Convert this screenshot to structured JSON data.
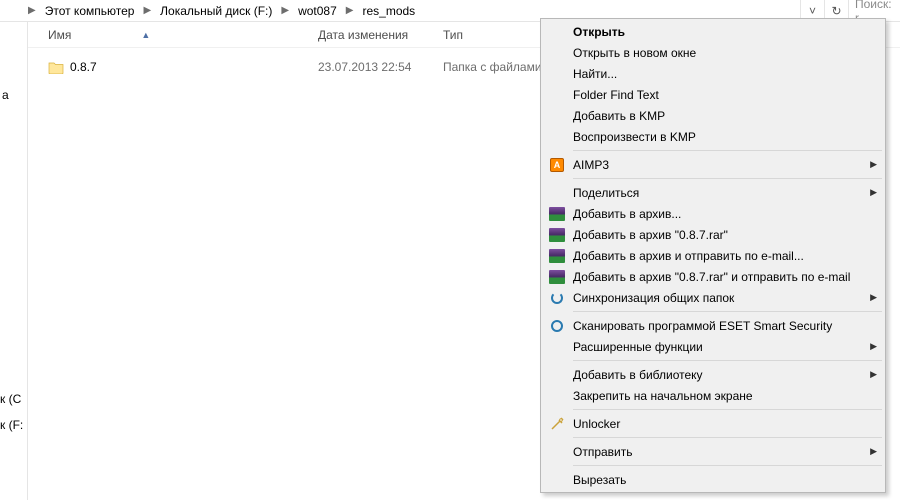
{
  "breadcrumb": {
    "items": [
      "Этот компьютер",
      "Локальный диск (F:)",
      "wot087",
      "res_mods"
    ]
  },
  "search": {
    "placeholder": "Поиск: r"
  },
  "columns": {
    "name": "Имя",
    "date": "Дата изменения",
    "type": "Тип"
  },
  "rows": [
    {
      "name": "0.8.7",
      "date": "23.07.2013 22:54",
      "type": "Папка с файлами"
    }
  ],
  "sidebar": {
    "item_a": "а",
    "item_c": "ск (C",
    "item_f": "ск (F:"
  },
  "context_menu": {
    "open": "Открыть",
    "open_new_window": "Открыть в новом окне",
    "find": "Найти...",
    "folder_find_text": "Folder Find Text",
    "add_kmp": "Добавить в KMP",
    "play_kmp": "Воспроизвести в KMP",
    "aimp3": "AIMP3",
    "share": "Поделиться",
    "add_archive": "Добавить в архив...",
    "add_archive_087": "Добавить в архив \"0.8.7.rar\"",
    "add_archive_email": "Добавить в архив и отправить по e-mail...",
    "add_archive_087_email": "Добавить в архив \"0.8.7.rar\" и отправить по e-mail",
    "sync_shared": "Синхронизация общих папок",
    "eset_scan": "Сканировать программой ESET Smart Security",
    "advanced": "Расширенные функции",
    "add_library": "Добавить в библиотеку",
    "pin_start": "Закрепить на начальном экране",
    "unlocker": "Unlocker",
    "send": "Отправить",
    "cut": "Вырезать"
  }
}
